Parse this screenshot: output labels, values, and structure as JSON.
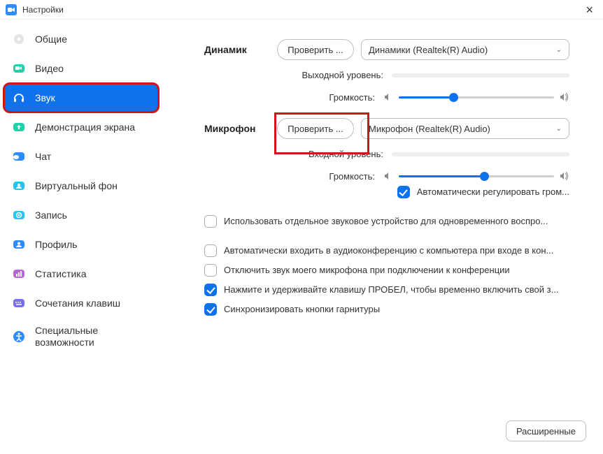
{
  "window": {
    "title": "Настройки"
  },
  "sidebar": {
    "items": [
      {
        "label": "Общие"
      },
      {
        "label": "Видео"
      },
      {
        "label": "Звук"
      },
      {
        "label": "Демонстрация экрана"
      },
      {
        "label": "Чат"
      },
      {
        "label": "Виртуальный фон"
      },
      {
        "label": "Запись"
      },
      {
        "label": "Профиль"
      },
      {
        "label": "Статистика"
      },
      {
        "label": "Сочетания клавиш"
      },
      {
        "label": "Специальные возможности"
      }
    ]
  },
  "speaker": {
    "section": "Динамик",
    "test": "Проверить ...",
    "device": "Динамики (Realtek(R) Audio)",
    "output_label": "Выходной уровень:",
    "volume_label": "Громкость:",
    "volume_pct": 35
  },
  "mic": {
    "section": "Микрофон",
    "test": "Проверить ...",
    "device": "Микрофон (Realtek(R) Audio)",
    "input_label": "Входной уровень:",
    "volume_label": "Громкость:",
    "volume_pct": 55,
    "auto_gain": "Автоматически регулировать гром..."
  },
  "options": {
    "separate_device": "Использовать отдельное звуковое устройство для одновременного воспро...",
    "auto_join": "Автоматически входить в аудиоконференцию с компьютера при входе в кон...",
    "mute_on_join": "Отключить звук моего микрофона при подключении к конференции",
    "push_to_talk": "Нажмите и удерживайте клавишу ПРОБЕЛ, чтобы временно включить свой з...",
    "sync_headset": "Синхронизировать кнопки гарнитуры"
  },
  "advanced": "Расширенные"
}
